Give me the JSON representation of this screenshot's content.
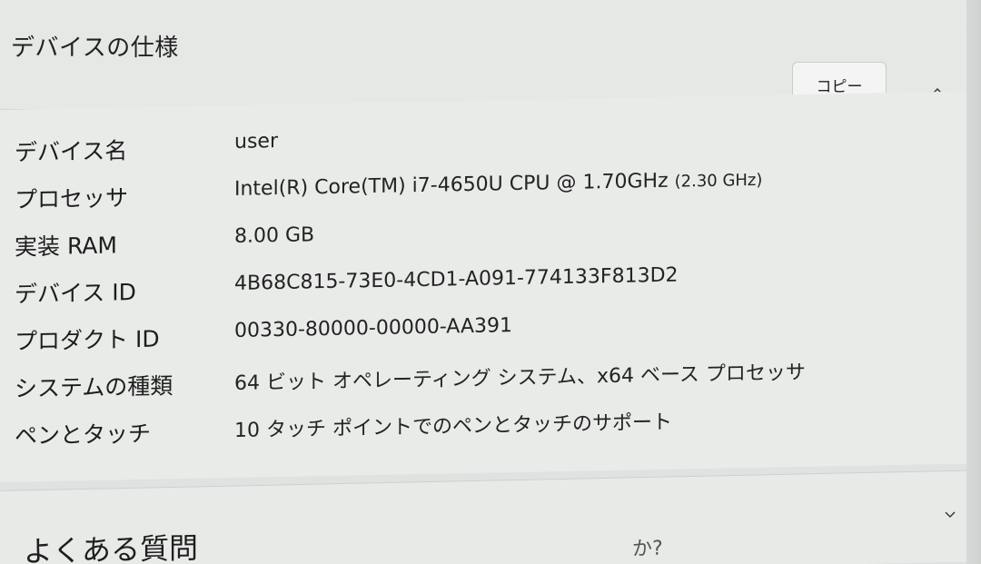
{
  "spec_section": {
    "title": "デバイスの仕様",
    "copy_label": "コピー",
    "rows": [
      {
        "label": "デバイス名",
        "value": "user"
      },
      {
        "label": "プロセッサ",
        "value": "Intel(R) Core(TM) i7-4650U CPU @ 1.70GHz",
        "value_suffix": "(2.30 GHz)"
      },
      {
        "label": "実装 RAM",
        "value": "8.00 GB"
      },
      {
        "label": "デバイス ID",
        "value": "4B68C815-73E0-4CD1-A091-774133F813D2"
      },
      {
        "label": "プロダクト ID",
        "value": "00330-80000-00000-AA391"
      },
      {
        "label": "システムの種類",
        "value": "64 ビット オペレーティング システム、x64 ベース プロセッサ"
      },
      {
        "label": "ペンとタッチ",
        "value": "10 タッチ ポイントでのペンとタッチのサポート"
      }
    ]
  },
  "faq_section": {
    "title": "よくある質問",
    "partial_text": "か?"
  },
  "icons": {
    "collapse": "chevron-up-icon",
    "expand": "chevron-down-icon"
  },
  "colors": {
    "background": "#e6e8e6",
    "text": "#1f1f1f",
    "border": "#cdd0ce"
  }
}
